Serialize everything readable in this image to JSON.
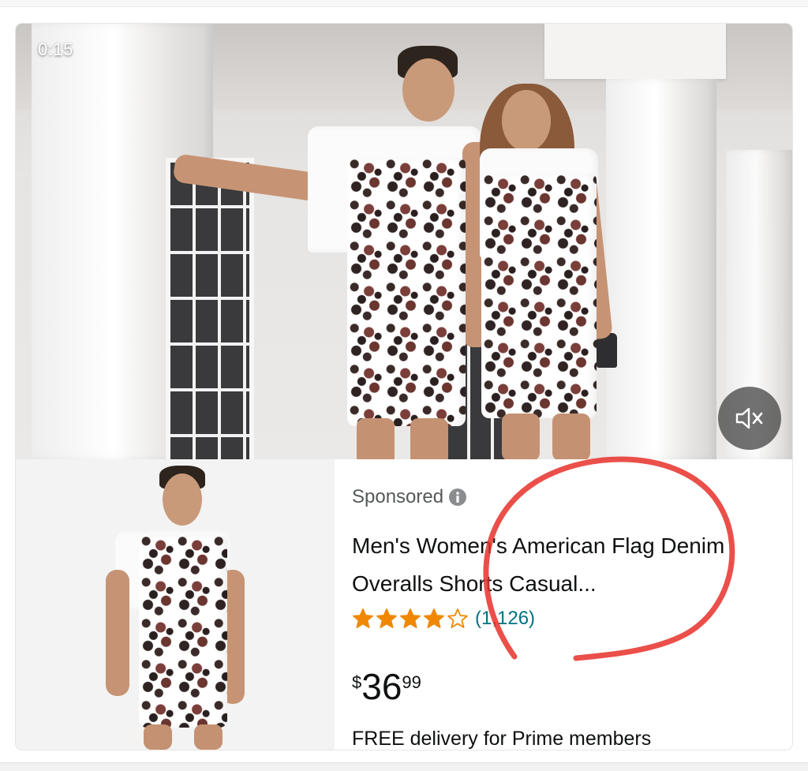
{
  "video": {
    "timestamp": "0:15",
    "mute_icon": "speaker-muted-icon"
  },
  "product": {
    "sponsored_label": "Sponsored",
    "info_icon": "info-icon",
    "title": "Men's Women's American Flag Denim Overalls Shorts Casual...",
    "rating": {
      "stars_filled": 4,
      "stars_total": 5,
      "count": "(1,126)"
    },
    "price": {
      "symbol": "$",
      "whole": "36",
      "fraction": "99"
    },
    "delivery": "FREE delivery for Prime members"
  },
  "colors": {
    "star": "#f08804",
    "annotation": "#e8302a",
    "link": "#007185"
  }
}
